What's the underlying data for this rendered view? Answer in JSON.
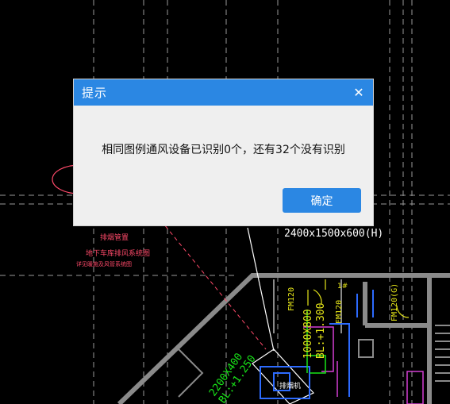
{
  "dialog": {
    "title": "提示",
    "close_glyph": "✕",
    "message": "相同图例通风设备已识别0个，还有32个没有识别",
    "ok_label": "确定"
  },
  "drawing": {
    "dimension_label": "2400x1500x600(H)",
    "equipment_label": "排烟机",
    "duct_label_1": "1000X800",
    "duct_label_2": "BL:+1.300",
    "duct_label_3": "2200X400",
    "duct_label_4": "BL:+1.250",
    "door_label_1": "FM120",
    "door_label_2": "FM120",
    "door_label_3": "FM120(G)",
    "room_label": "1#",
    "red_label_1": "排烟管置",
    "red_label_2": "地下车库排风系统图",
    "red_label_3": "详见暖施及风管系统图",
    "colors": {
      "background": "#000000",
      "dialog_accent": "#2b87e3",
      "wall": "#8a8a8a",
      "green": "#19e619",
      "yellow": "#e6e619",
      "blue": "#2d6bff",
      "magenta": "#d63fd6",
      "red": "#ff4a6a"
    }
  }
}
